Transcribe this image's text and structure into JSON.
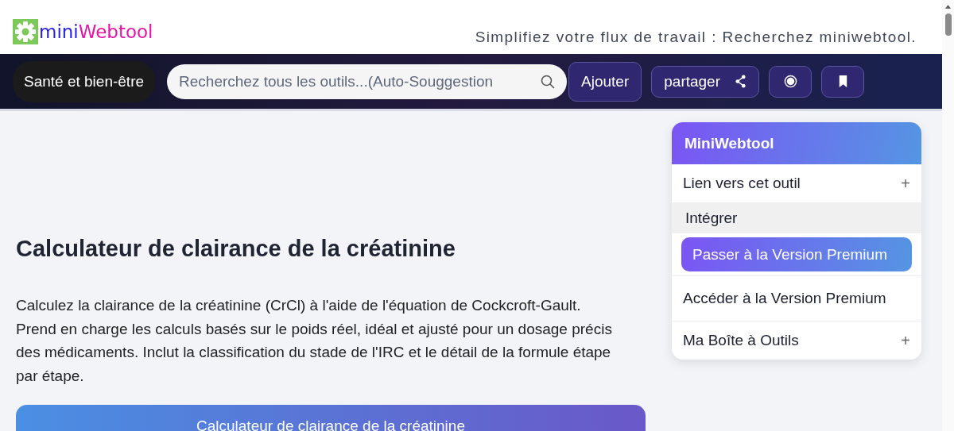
{
  "header": {
    "logo_part_1": "mini",
    "logo_part_2": "Webtool",
    "tagline": "Simplifiez votre flux de travail : Recherchez miniwebtool."
  },
  "navbar": {
    "category": "Santé et bien-être",
    "search": {
      "placeholder": "Recherchez tous les outils...(Auto-Souggestion"
    },
    "add_button": "Ajouter",
    "share_button": "partager"
  },
  "main": {
    "title": "Calculateur de clairance de la créatinine",
    "description": "Calculez la clairance de la créatinine (CrCl) à l'aide de l'équation de Cockcroft-Gault. Prend en charge les calculs basés sur le poids réel, idéal et ajusté pour un dosage précis des médicaments. Inclut la classification du stade de l'IRC et le détail de la formule étape par étape.",
    "card_title": "Calculateur de clairance de la créatinine"
  },
  "sidebar": {
    "title": "MiniWebtool",
    "items": [
      {
        "kind": "expand",
        "label": "Lien vers cet outil",
        "plus": "+"
      },
      {
        "kind": "sub",
        "label": "Intégrer"
      },
      {
        "kind": "premium",
        "label": "Passer à la Version Premium"
      },
      {
        "kind": "link",
        "label": "Accéder à la Version Premium"
      },
      {
        "kind": "expand",
        "label": "Ma Boîte à Outils",
        "plus": "+"
      }
    ]
  }
}
